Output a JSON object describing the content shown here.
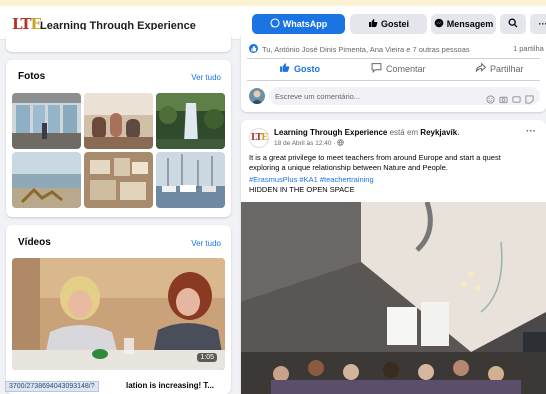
{
  "header": {
    "logo_main": "LT",
    "logo_accent": "E",
    "page_name": "Learning Through Experience",
    "whatsapp_label": "WhatsApp",
    "like_label": "Gostei",
    "message_label": "Mensagem"
  },
  "photos": {
    "title": "Fotos",
    "see_all": "Ver tudo"
  },
  "videos": {
    "title": "Vídeos",
    "see_all": "Ver tudo",
    "duration": "1:05",
    "caption_tail": "lation is increasing! T..."
  },
  "prev_post": {
    "reactions": "Tu, António José Dinis Pimenta, Ana Vieira e 7 outras pessoas",
    "shares": "1 partilha",
    "like": "Gosto",
    "comment": "Comentar",
    "share": "Partilhar",
    "comment_placeholder": "Escreve um comentário..."
  },
  "post": {
    "author": "Learning Through Experience",
    "location_prefix": "está em",
    "location": "Reykjavík",
    "date": "18 de Abril às 12:40 ·",
    "text": "It is a great privilege to meet teachers from around Europe and start a quest exploring a unique relationship between Nature and People.",
    "hashtags": "#ErasmusPlus #KA1 #teachertraining",
    "extra": "HIDDEN IN THE OPEN SPACE",
    "more": "···"
  },
  "status_bar": {
    "url": "3700/2738694043093148/?"
  },
  "colors": {
    "accent": "#1b74e4",
    "logo_red": "#b5342a",
    "logo_gold": "#c9a227",
    "background": "#f0f2f5"
  }
}
